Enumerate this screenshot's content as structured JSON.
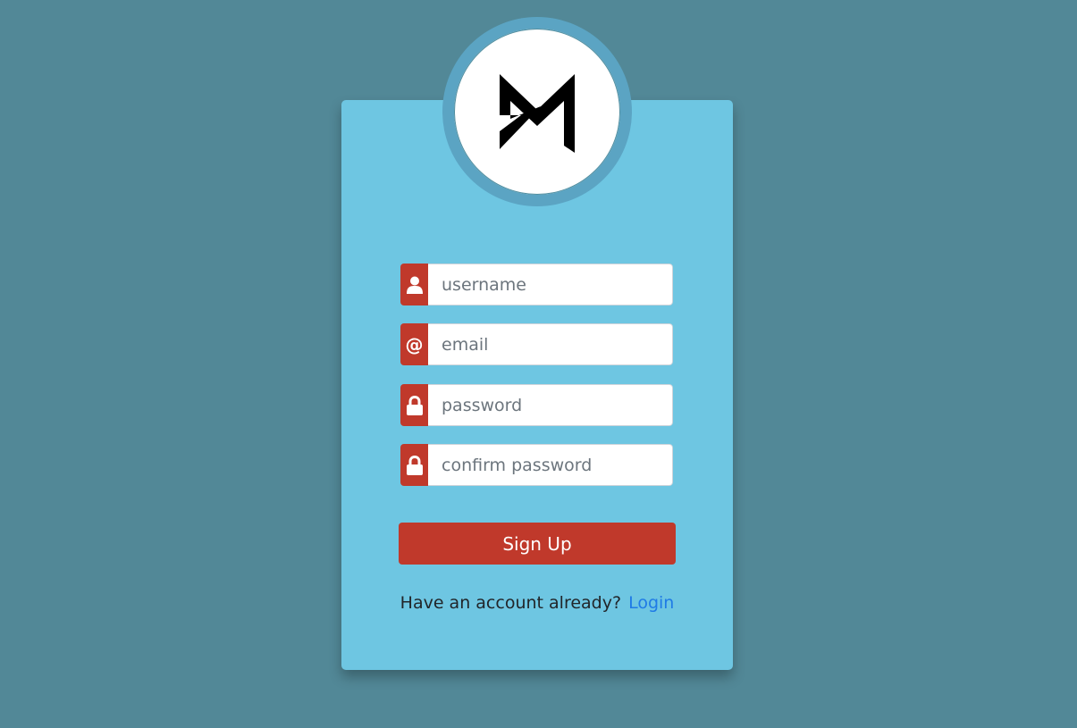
{
  "logo": {
    "icon": "m-logo-icon"
  },
  "form": {
    "username": {
      "placeholder": "username",
      "icon": "user-icon"
    },
    "email": {
      "placeholder": "email",
      "icon": "at-icon",
      "glyph": "@"
    },
    "password": {
      "placeholder": "password",
      "icon": "lock-icon"
    },
    "confirm_password": {
      "placeholder": "confirm password",
      "icon": "lock-icon"
    }
  },
  "signup_button": "Sign Up",
  "footer": {
    "text": "Have an account already?",
    "link": "Login"
  },
  "colors": {
    "background": "#528897",
    "card": "#6ec6e2",
    "accent": "#c0392b",
    "link": "#1f7be6"
  }
}
